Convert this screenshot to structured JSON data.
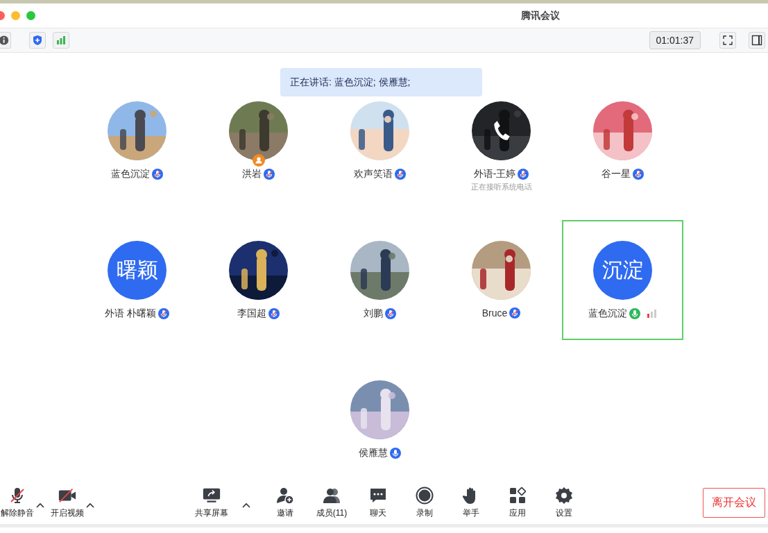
{
  "window": {
    "title": "腾讯会议"
  },
  "toolbar": {
    "timer": "01:01:37"
  },
  "speaking_banner": "正在讲话: 蓝色沉淀; 侯雁慧;",
  "participants": [
    {
      "name": "蓝色沉淀",
      "muted": true,
      "selected": false
    },
    {
      "name": "洪岩",
      "muted": true,
      "host": true,
      "selected": false
    },
    {
      "name": "欢声笑语",
      "muted": true,
      "selected": false
    },
    {
      "name": "外语-王婷",
      "muted": true,
      "on_call": true,
      "status": "正在接听系统电话",
      "selected": false
    },
    {
      "name": "谷一星",
      "muted": true,
      "selected": false
    },
    {
      "name": "外语 朴曙颖",
      "avatar": {
        "kind": "initials",
        "text": "曙颖"
      },
      "muted": true,
      "selected": false
    },
    {
      "name": "李国超",
      "muted": true,
      "selected": false
    },
    {
      "name": "刘鹏",
      "muted": true,
      "selected": false
    },
    {
      "name": "Bruce",
      "muted": true,
      "selected": false
    },
    {
      "name": "蓝色沉淀",
      "avatar": {
        "kind": "initials",
        "text": "沉淀"
      },
      "muted": false,
      "selected": true
    },
    {
      "name": "侯雁慧",
      "muted": false,
      "selected": false
    }
  ],
  "controls_left": [
    {
      "label": "解除静音",
      "kind": "mic-muted",
      "menu": true
    },
    {
      "label": "开启视频",
      "kind": "video-off",
      "menu": true
    }
  ],
  "controls_center": [
    {
      "label": "共享屏幕",
      "kind": "share",
      "menu": true
    },
    {
      "label": "邀请",
      "kind": "invite",
      "menu": false
    },
    {
      "label": "成员(11)",
      "kind": "members",
      "menu": false
    },
    {
      "label": "聊天",
      "kind": "chat",
      "menu": false
    },
    {
      "label": "录制",
      "kind": "record",
      "menu": false
    },
    {
      "label": "举手",
      "kind": "hand",
      "menu": false
    },
    {
      "label": "应用",
      "kind": "apps",
      "menu": false
    },
    {
      "label": "设置",
      "kind": "settings",
      "menu": false
    }
  ],
  "leave_button": "离开会议"
}
